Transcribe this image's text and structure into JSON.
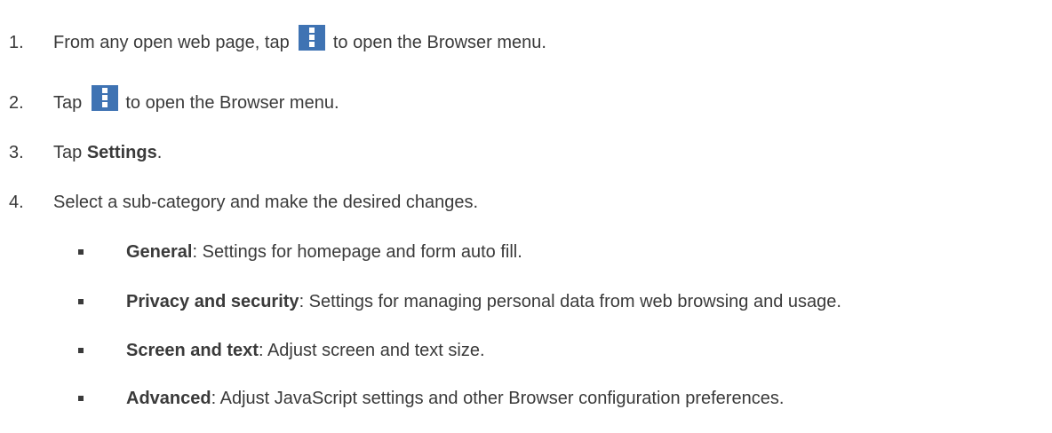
{
  "steps": [
    {
      "num": "1.",
      "pre": "From any open web page, tap ",
      "post": " to open the Browser menu."
    },
    {
      "num": "2.",
      "pre": "Tap ",
      "post": " to open the Browser menu."
    },
    {
      "num": "3.",
      "pre": "Tap ",
      "bold": "Settings",
      "post": "."
    },
    {
      "num": "4.",
      "text": "Select a sub-category and make the desired changes."
    }
  ],
  "subitems": [
    {
      "bold": "General",
      "text": ": Settings for homepage and form auto fill."
    },
    {
      "bold": "Privacy and security",
      "text": ": Settings for managing personal data from web browsing and usage."
    },
    {
      "bold": "Screen and text",
      "text": ": Adjust screen and text size."
    },
    {
      "bold": "Advanced",
      "text": ": Adjust JavaScript settings and other Browser configuration preferences."
    }
  ],
  "colors": {
    "text": "#3a3a3a",
    "menu_icon_bg": "#3f73b3"
  },
  "icons": {
    "menu": "overflow-menu-icon"
  }
}
